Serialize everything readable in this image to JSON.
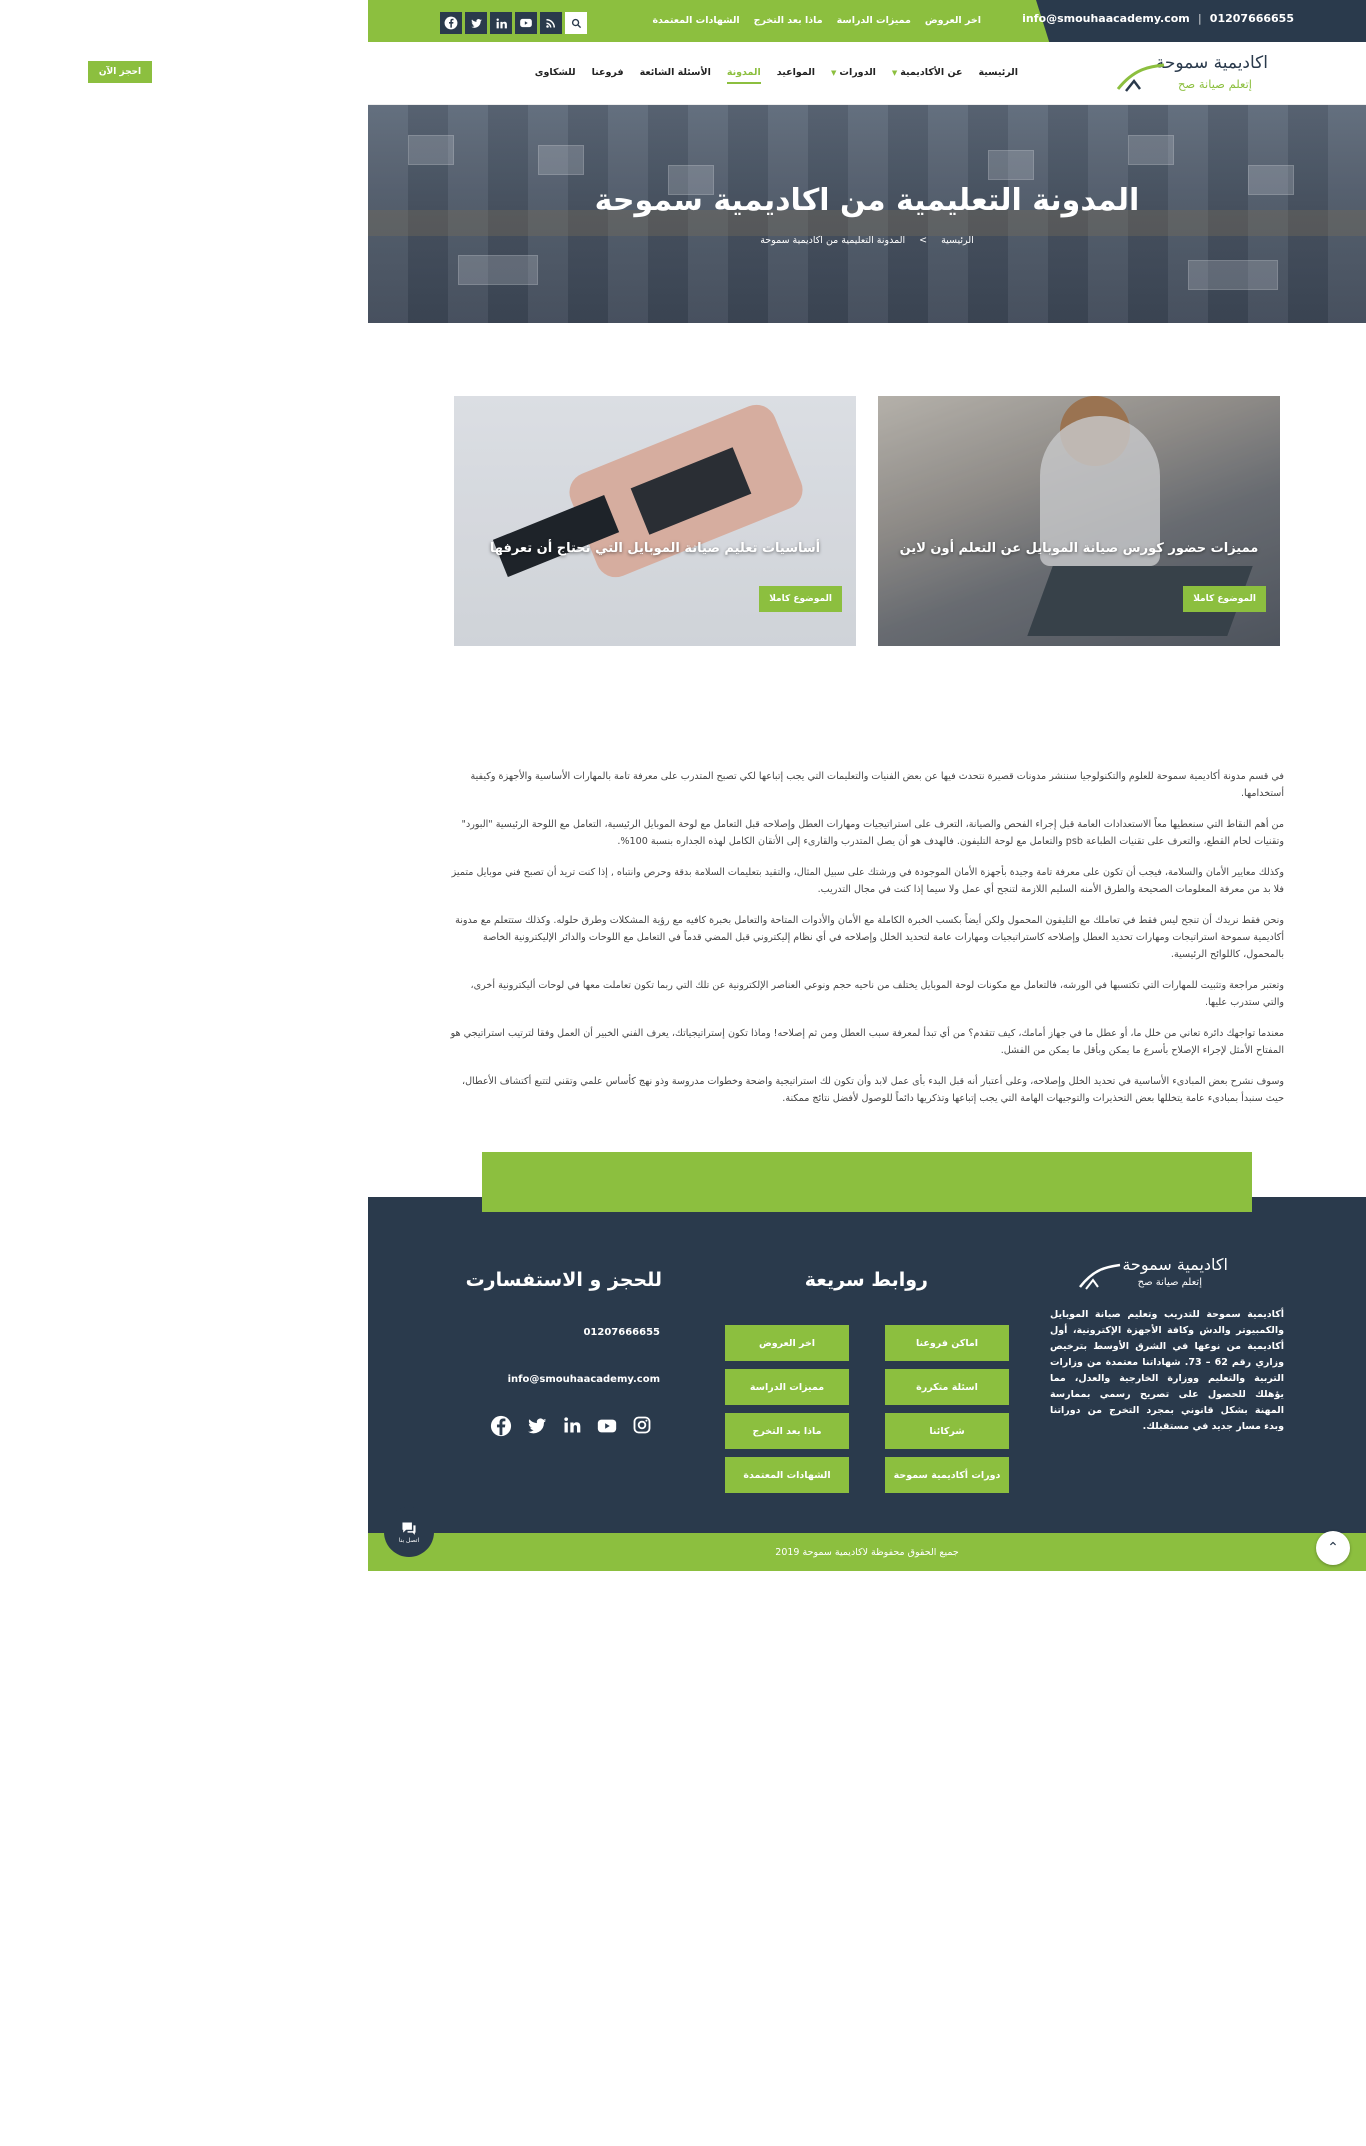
{
  "topbar": {
    "phone": "01207666655",
    "email": "info@smouhaacademy.com",
    "links": [
      "اخر العروض",
      "مميزات الدراسة",
      "ماذا بعد التخرج",
      "الشهادات المعتمدة"
    ],
    "social_icons": [
      "facebook-icon",
      "twitter-icon",
      "linkedin-icon",
      "youtube-icon",
      "rss-icon",
      "search-icon"
    ]
  },
  "header": {
    "logo_line1": "اكاديمية سموحة",
    "logo_line2": "إتعلم صيانة صح",
    "nav": [
      {
        "label": "الرئيسية",
        "dropdown": false,
        "active": false
      },
      {
        "label": "عن الأكاديمية",
        "dropdown": true,
        "active": false
      },
      {
        "label": "الدورات",
        "dropdown": true,
        "active": false
      },
      {
        "label": "المواعيد",
        "dropdown": false,
        "active": false
      },
      {
        "label": "المدونة",
        "dropdown": false,
        "active": true
      },
      {
        "label": "الأسئلة الشائعة",
        "dropdown": false,
        "active": false
      },
      {
        "label": "فروعنا",
        "dropdown": false,
        "active": false
      },
      {
        "label": "للشكاوى",
        "dropdown": false,
        "active": false
      }
    ],
    "book_label": "احجز الآن"
  },
  "hero": {
    "title": "المدونة التعليمية من اكاديمية سموحة",
    "crumb_home": "الرئيسية",
    "crumb_sep": ">",
    "crumb_current": "المدونة التعليمية من اكاديمية سموحة"
  },
  "cards": [
    {
      "title": "مميزات حضور كورس صيانة الموبايل عن التعلم أون لاين",
      "button": "الموضوع كاملا"
    },
    {
      "title": "أساسيات تعليم صيانة الموبايل التي تحتاج أن تعرفها",
      "button": "الموضوع كاملا"
    }
  ],
  "article": [
    "في قسم مدونة أكاديمية سموحة للعلوم والتكنولوجيا سننشر مدونات قصيرة نتحدث فيها عن بعض الفنيات والتعليمات التي يجب إتباعها لكي تصبح المتدرب على معرفة تامة بالمهارات الأساسية والأجهزة وكيفية أستخدامها.",
    "من أهم النقاط التي سنعطيها معاً الاستعدادات العامة قبل إجراء الفحص والصيانة، التعرف على استراتيجيات ومهارات العطل وإصلاحه قبل التعامل مع لوحة الموبايل الرئيسية، التعامل مع اللوحة الرئيسية \"البورد\" وتقنيات لحام القطع، والتعرف على تقنيات الطباعة psb والتعامل مع لوحة التليفون. فالهدف هو أن يصل المتدرب والقارىء إلى الأتقان الكامل لهذه الجداره بنسبة 100%.",
    "وكذلك معايير الأمان والسلامة، فيجب أن تكون على معرفة تامة وجيدة بأجهزة الأمان الموجودة في ورشتك على سبيل المثال، والتقيد بتعليمات السلامة بدقة وحرص وانتباه , إذا كنت تريد أن تصبح فني موبايل متميز فلا بد من معرفة المعلومات الصحيحة والطرق الأمنه السليم اللازمة لتنجح أي عمل ولا سيما إذا كنت في مجال التدريب.",
    "ونحن فقط نريدك أن تنجح ليس فقط في تعاملك مع التليفون المحمول ولكن أيضاً بكسب الخبرة الكاملة مع الأمان والأدوات المتاحة والتعامل بخبرة كافيه مع رؤية المشكلات وطرق حلوله. وكذلك ستتعلم مع مدونة أكاديمية سموحة استراتيجات ومهارات تحديد العطل وإصلاحه كاستراتيجيات ومهارات عامة لتحديد الخلل وإصلاحه في أي نظام إليكتروني قبل المضي قدماً في التعامل مع اللوحات والدائر الإليكترونية الخاصة بالمحمول، كاللوائح الرئيسية.",
    "وتعتبر مراجعة وتثبيت للمهارات التي تكتسبها في الورشه، فالتعامل مع مكونات لوحة الموبايل يختلف من ناحيه حجم ونوعي العناصر الإلكترونية عن تلك التي ربما تكون تعاملت معها في لوحات أليكترونية أخرى، والتي ستدرب عليها.",
    "معندما تواجهك دائرة تعاني من خلل ما، أو عطل ما في جهاز أمامك، كيف تتقدم؟ من أي تبدأ لمعرفة سبب العطل ومن ثم إصلاحه! وماذا تكون إستراتيجياتك، يعرف الفني الخبير أن العمل وفقا لترتيب استراتيجي هو المفتاح الأمثل لإجراء الإصلاح بأسرع ما يمكن وبأقل ما يمكن من الفشل.",
    "وسوف نشرح بعض المبادىء الأساسية في تحديد الخلل وإصلاحه، وعلى أعتبار أنه قبل البدء بأى عمل لابد وأن تكون لك استراتيجية واضحة وخطوات مدروسة وذو نهج كأساس علمي وتقني لتتبع أكتشاف الأعطال، حيث سنبدأ بمبادىء عامة يتخللها بعض التحذيرات والتوجيهات الهامة التي يجب إتباعها وتذكريها دائماً للوصول لأفضل نتائج ممكنة."
  ],
  "footer": {
    "logo_line1": "اكاديمية سموحة",
    "logo_line2": "إتعلم صيانة صح",
    "about": "أكاديمية سموحة للتدريب وتعليم صيانة الموبايل والكمبيوتر والدش وكافة الأجهزة الإكترونية، أول أكاديمية من نوعها في الشرق الأوسط بترخيص وزاري رقم 62 – 73. شهاداتنا معتمدة من وزارات التربية والتعليم ووزارة الخارجية والعدل، مما يؤهلك للحصول على تصريح رسمي بممارسة المهنة بشكل قانوني بمجرد التخرج من دوراتنا وبدء مسار جديد في مستقبلك.",
    "links_heading": "روابط سريعة",
    "booking_heading": "للحجز و الاستفسارت",
    "links": [
      "اماكن فروعنا",
      "اخر العروض",
      "اسئلة متكررة",
      "مميزات الدراسة",
      "شركائنا",
      "ماذا بعد التخرج",
      "دورات أكاديمية سموحة",
      "الشهادات المعتمدة"
    ],
    "phone": "01207666655",
    "email": "info@smouhaacademy.com",
    "social_icons": [
      "facebook-icon",
      "twitter-icon",
      "linkedin-icon",
      "youtube-icon",
      "instagram-icon"
    ],
    "copyright": "جميع الحقوق محفوظة لاكاديمية سموحة 2019",
    "chat_label": "اتصل بنا"
  },
  "colors": {
    "accent": "#8cbf3f",
    "dark": "#2a3a4c"
  }
}
